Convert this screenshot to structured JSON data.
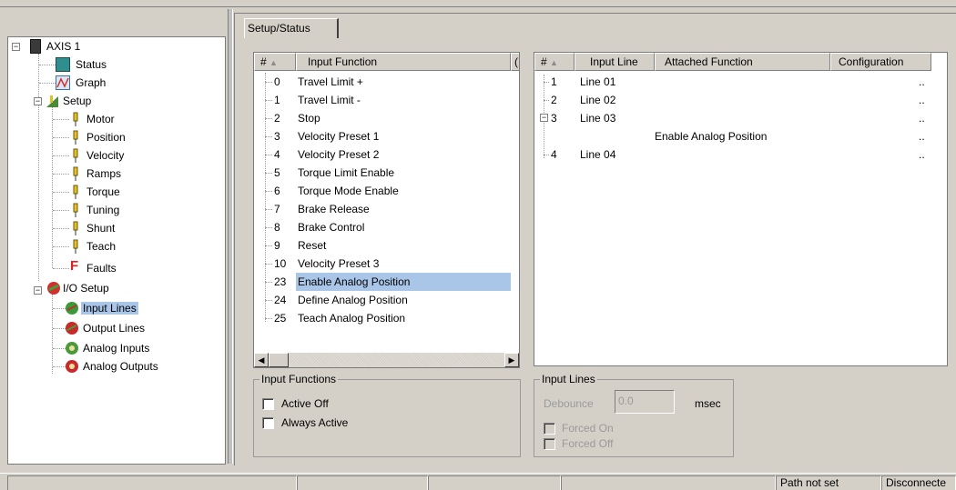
{
  "tree": {
    "root": "AXIS 1",
    "items": [
      {
        "label": "Status",
        "icon": "status-icon"
      },
      {
        "label": "Graph",
        "icon": "graph-icon"
      },
      {
        "label": "Setup",
        "icon": "setup-icon"
      },
      {
        "label": "Motor",
        "icon": "pin-icon"
      },
      {
        "label": "Position",
        "icon": "pin-icon"
      },
      {
        "label": "Velocity",
        "icon": "pin-icon"
      },
      {
        "label": "Ramps",
        "icon": "pin-icon"
      },
      {
        "label": "Torque",
        "icon": "pin-icon"
      },
      {
        "label": "Tuning",
        "icon": "pin-icon"
      },
      {
        "label": "Shunt",
        "icon": "pin-icon"
      },
      {
        "label": "Teach",
        "icon": "pin-icon"
      },
      {
        "label": "Faults",
        "icon": "faults-icon"
      },
      {
        "label": "I/O Setup",
        "icon": "io-icon"
      },
      {
        "label": "Input Lines",
        "icon": "input-lines-icon"
      },
      {
        "label": "Output Lines",
        "icon": "output-lines-icon"
      },
      {
        "label": "Analog Inputs",
        "icon": "analog-inputs-icon"
      },
      {
        "label": "Analog Outputs",
        "icon": "analog-outputs-icon"
      }
    ],
    "selected": "Input Lines"
  },
  "tab": {
    "label": "Setup/Status"
  },
  "functions": {
    "headers": [
      "#",
      "Input Function",
      "("
    ],
    "rows": [
      {
        "num": "0",
        "name": "Travel Limit +"
      },
      {
        "num": "1",
        "name": "Travel Limit -"
      },
      {
        "num": "2",
        "name": "Stop"
      },
      {
        "num": "3",
        "name": "Velocity Preset 1"
      },
      {
        "num": "4",
        "name": "Velocity Preset 2"
      },
      {
        "num": "5",
        "name": "Torque Limit Enable"
      },
      {
        "num": "6",
        "name": "Torque Mode Enable"
      },
      {
        "num": "7",
        "name": "Brake Release"
      },
      {
        "num": "8",
        "name": "Brake Control"
      },
      {
        "num": "9",
        "name": "Reset"
      },
      {
        "num": "10",
        "name": "Velocity Preset 3"
      },
      {
        "num": "23",
        "name": "Enable Analog Position"
      },
      {
        "num": "24",
        "name": "Define Analog Position"
      },
      {
        "num": "25",
        "name": "Teach Analog Position"
      }
    ],
    "selected": "Enable Analog Position"
  },
  "lines": {
    "headers": [
      "#",
      "Input Line",
      "Attached Function",
      "Configuration"
    ],
    "rows": [
      {
        "num": "1",
        "line": "Line 01",
        "func": "",
        "config": ".."
      },
      {
        "num": "2",
        "line": "Line 02",
        "func": "",
        "config": ".."
      },
      {
        "num": "3",
        "line": "Line 03",
        "func": "",
        "config": ".."
      },
      {
        "num": "",
        "line": "",
        "func": "Enable Analog Position",
        "config": ".."
      },
      {
        "num": "4",
        "line": "Line 04",
        "func": "",
        "config": ".."
      }
    ]
  },
  "input_functions_group": {
    "title": "Input Functions",
    "active_off": "Active Off",
    "always_active": "Always Active"
  },
  "input_lines_group": {
    "title": "Input Lines",
    "debounce_label": "Debounce",
    "debounce_value": "0.0",
    "unit": "msec",
    "forced_on": "Forced On",
    "forced_off": "Forced Off"
  },
  "status_bar": {
    "path": "Path not set",
    "connection": "Disconnecte"
  },
  "colors": {
    "selection": "#a9c6e9",
    "background": "#d4d0c8"
  }
}
